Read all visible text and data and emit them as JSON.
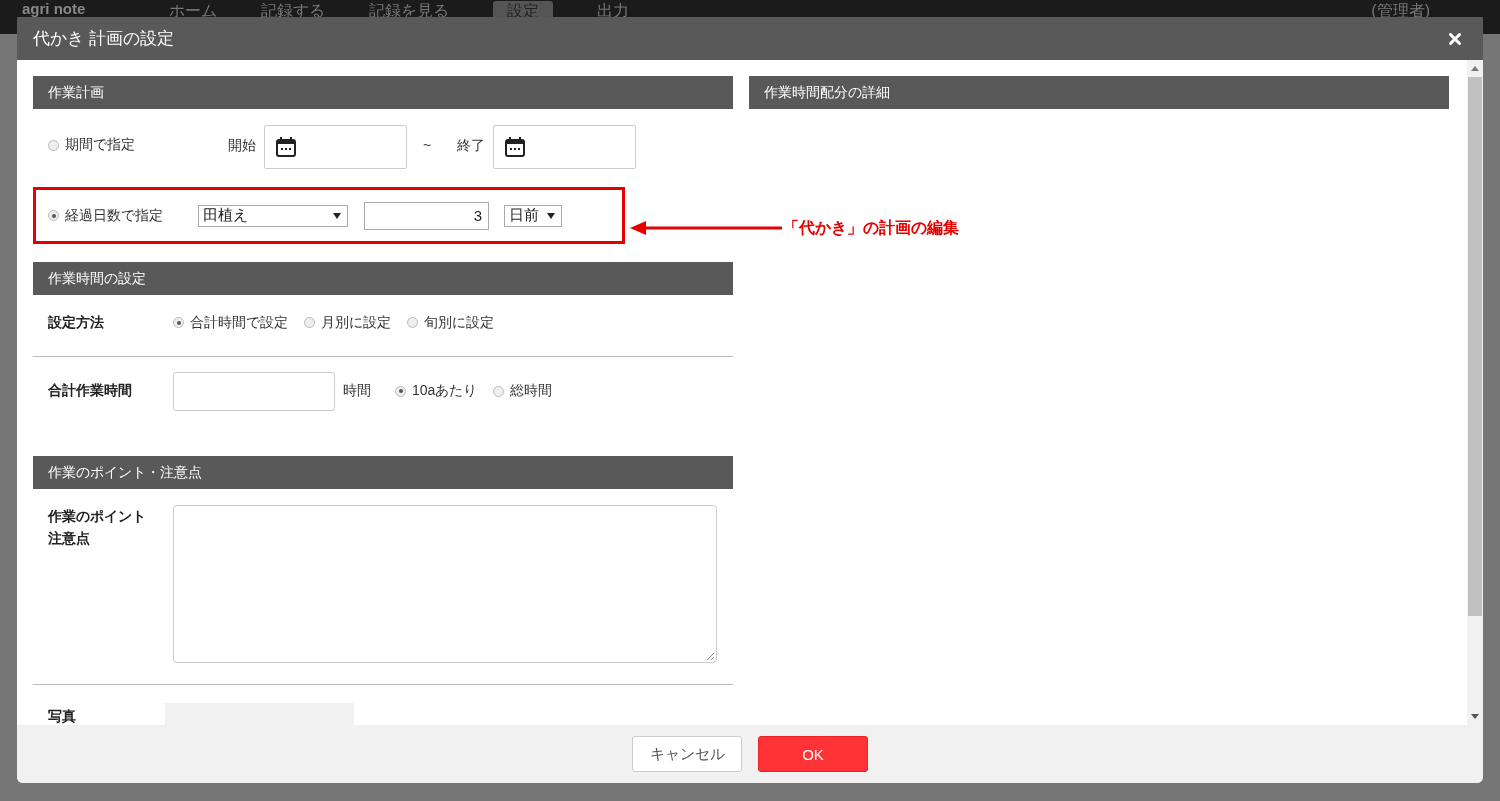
{
  "app_nav": {
    "logo": "agri note",
    "items": [
      {
        "label": "ホーム",
        "selected": false
      },
      {
        "label": "記録する",
        "selected": false
      },
      {
        "label": "記録を見る",
        "selected": false
      },
      {
        "label": "設定",
        "selected": true
      },
      {
        "label": "出力",
        "selected": false
      }
    ],
    "user": "(管理者)"
  },
  "dialog": {
    "title": "代かき 計画の設定"
  },
  "plan": {
    "heading": "作業計画",
    "options": [
      {
        "kind": "period",
        "label": "期間で指定",
        "selected": false,
        "start_label": "開始",
        "separator": "~",
        "end_label": "終了"
      },
      {
        "kind": "days",
        "label": "経過日数で指定",
        "selected": true,
        "base": "田植え",
        "days": "3",
        "unit": "日前"
      }
    ]
  },
  "time": {
    "heading": "作業時間の設定",
    "method_label": "設定方法",
    "methods": [
      {
        "label": "合計時間で設定",
        "selected": true
      },
      {
        "label": "月別に設定",
        "selected": false
      },
      {
        "label": "旬別に設定",
        "selected": false
      }
    ],
    "total_label": "合計作業時間",
    "unit": "時間",
    "bases": [
      {
        "label": "10aあたり",
        "selected": true
      },
      {
        "label": "総時間",
        "selected": false
      }
    ]
  },
  "points": {
    "heading": "作業のポイント・注意点",
    "label_lines": [
      "作業のポイント",
      "注意点"
    ]
  },
  "photo": {
    "label": "写真"
  },
  "details": {
    "heading": "作業時間配分の詳細"
  },
  "annotation": {
    "text": "「代かき」の計画の編集"
  },
  "buttons": [
    {
      "kind": "cancel",
      "label": "キャンセル"
    },
    {
      "kind": "ok",
      "label": "OK"
    }
  ]
}
